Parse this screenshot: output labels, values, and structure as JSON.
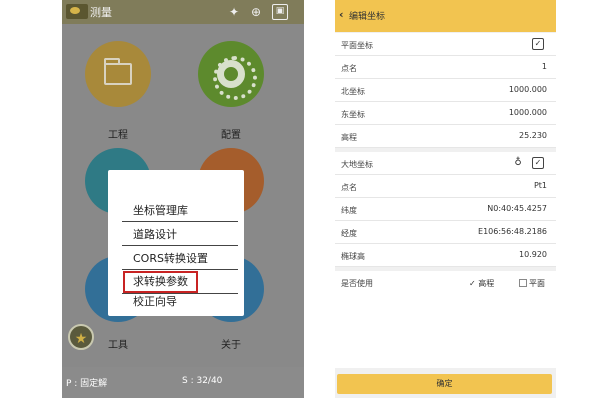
{
  "left_screen": {
    "app_title": "测量",
    "status_icons": [
      "satellite-icon",
      "gps-antenna-icon",
      "settings-window-icon"
    ],
    "apps": [
      {
        "label": "工程",
        "color": "#a8893a",
        "icon": "folder-icon"
      },
      {
        "label": "配置",
        "color": "#5d8a2d",
        "icon": "gear-icon"
      },
      {
        "label": "工具",
        "color": "#326f97",
        "icon": "tools-icon"
      },
      {
        "label": "关于",
        "color": "#326f97",
        "icon": "info-icon"
      }
    ],
    "popup_menu": [
      "坐标管理库",
      "道路设计",
      "CORS转换设置",
      "求转换参数",
      "校正向导"
    ],
    "highlighted_item": "求转换参数",
    "highlight_color": "#c82323",
    "footer": {
      "position_status": "P : 固定解",
      "satellites": "S : 32/40"
    }
  },
  "right_screen": {
    "header_title": "编辑坐标",
    "header_color": "#f2c450",
    "plane_section": {
      "title": "平面坐标",
      "rows": [
        {
          "label": "点名",
          "value": "1"
        },
        {
          "label": "北坐标",
          "value": "1000.000"
        },
        {
          "label": "东坐标",
          "value": "1000.000"
        },
        {
          "label": "高程",
          "value": "25.230"
        }
      ]
    },
    "geodetic_section": {
      "title": "大地坐标",
      "rows": [
        {
          "label": "点名",
          "value": "Pt1"
        },
        {
          "label": "纬度",
          "value": "N0:40:45.4257"
        },
        {
          "label": "经度",
          "value": "E106:56:48.2186"
        },
        {
          "label": "椭球高",
          "value": "10.920"
        }
      ]
    },
    "usage": {
      "label": "是否使用",
      "options": [
        {
          "label": "高程",
          "checked": true
        },
        {
          "label": "平面",
          "checked": false
        }
      ]
    },
    "confirm_label": "确定"
  }
}
